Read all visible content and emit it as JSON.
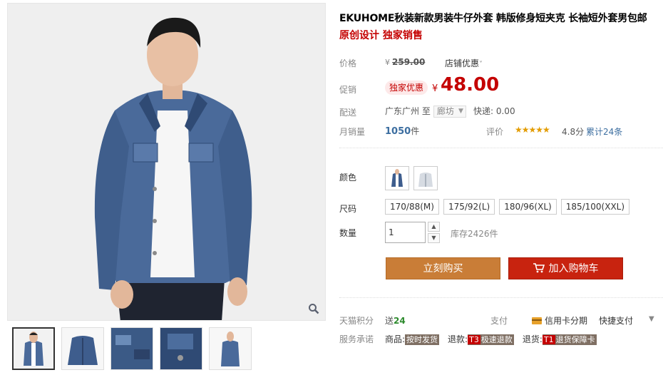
{
  "product": {
    "title": "EKUHOME秋装新款男装牛仔外套 韩版修身短夹克 长袖短外套男包邮",
    "subtitle": "原创设计 独家销售"
  },
  "price": {
    "label": "价格",
    "currency": "¥",
    "original": "259.00",
    "shop_promo": "店铺优惠"
  },
  "promotion": {
    "label": "促销",
    "tag": "独家优惠",
    "currency": "¥",
    "price": "48.00"
  },
  "shipping": {
    "label": "配送",
    "from": "广东广州",
    "to_word": "至",
    "destination": "廊坊",
    "fee": "快递: 0.00"
  },
  "sales": {
    "label": "月销量",
    "count": "1050",
    "unit": "件",
    "review_label": "评价",
    "stars": "★★★★★",
    "rating": 4.8,
    "score": "4.8分",
    "review_count": "累计24条"
  },
  "options": {
    "color_label": "颜色",
    "size_label": "尺码",
    "sizes": [
      "170/88(M)",
      "175/92(L)",
      "180/96(XL)",
      "185/100(XXL)"
    ],
    "quantity_label": "数量",
    "quantity": "1",
    "stock": "库存2426件"
  },
  "actions": {
    "buy_now": "立刻购买",
    "add_to_cart": "加入购物车"
  },
  "services": {
    "points_label": "天猫积分",
    "points_prefix": "送",
    "points_value": "24",
    "pay_label": "支付",
    "credit_card": "信用卡分期",
    "quick_pay": "快捷支付",
    "promise_label": "服务承诺",
    "goods_label": "商品:",
    "goods_tag": "按时发货",
    "refund_label": "退款:",
    "refund_t": "T3",
    "refund_tag": "极速退款",
    "return_label": "退货:",
    "return_t": "T1",
    "return_tag": "退货保障卡"
  },
  "icons": {
    "zoom": "magnifier-icon",
    "cart": "cart-icon",
    "card": "credit-card-icon"
  },
  "colors": {
    "accent_red": "#c40000",
    "buy_now_bg": "#c97d37",
    "add_cart_bg": "#c8230f",
    "link_blue": "#3c6ea0"
  }
}
